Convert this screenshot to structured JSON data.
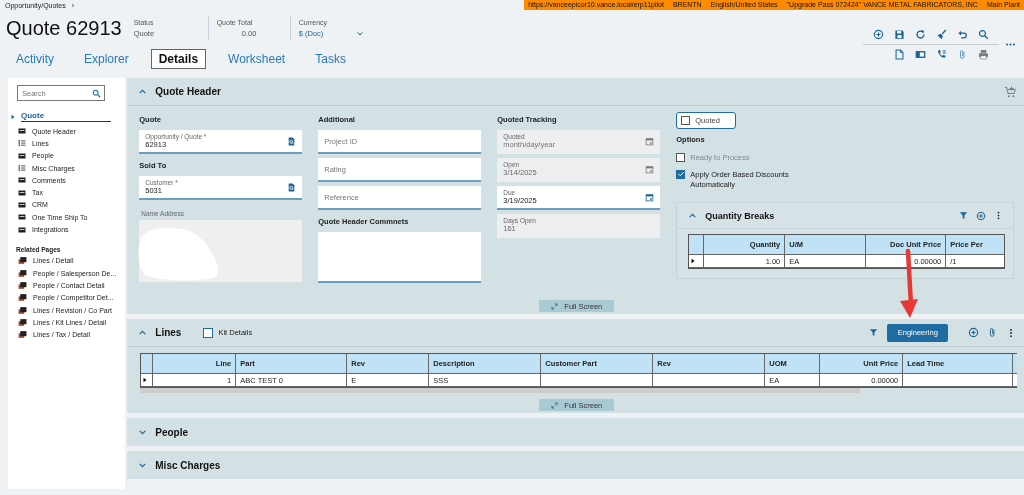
{
  "breadcrumb": {
    "text": "Opportunity/Quotes",
    "separator": "›"
  },
  "banner": [
    "https://vanceepicor10.vance.local/erp11pilot",
    "BRENTN",
    "English/United States",
    "\"Upgrade Pass 072424\" VANCE METAL FABRICATORS, INC",
    "Main Plant"
  ],
  "title": "Quote 62913",
  "summary": [
    {
      "kind": "text",
      "label": "Status",
      "value": "Quote"
    },
    {
      "kind": "number",
      "label": "Quote Total",
      "value": "0.00"
    },
    {
      "kind": "dropdown",
      "label": "Currency",
      "value": "$ (Doc)"
    }
  ],
  "tabs": [
    {
      "label": "Activity",
      "selected": false
    },
    {
      "label": "Explorer",
      "selected": false
    },
    {
      "label": "Details",
      "selected": true
    },
    {
      "label": "Worksheet",
      "selected": false
    },
    {
      "label": "Tasks",
      "selected": false
    }
  ],
  "sidebar": {
    "search_placeholder": "Search",
    "section": "Quote",
    "items": [
      {
        "label": "Quote Header",
        "kind": "form"
      },
      {
        "label": "Lines",
        "kind": "list"
      },
      {
        "label": "People",
        "kind": "form"
      },
      {
        "label": "Misc Charges",
        "kind": "list"
      },
      {
        "label": "Comments",
        "kind": "form"
      },
      {
        "label": "Tax",
        "kind": "form"
      },
      {
        "label": "CRM",
        "kind": "form"
      },
      {
        "label": "One Time Ship To",
        "kind": "form"
      },
      {
        "label": "Integrations",
        "kind": "form"
      }
    ],
    "related_title": "Related Pages",
    "related": [
      "Lines / Detail",
      "People / Salesperson De...",
      "People / Contact Detail",
      "People / Competitor Det...",
      "Lines / Revision / Co Part",
      "Lines / Kit Lines / Detail",
      "Lines / Tax / Detail"
    ]
  },
  "quote_header": {
    "title": "Quote Header",
    "expanded": true,
    "full_screen": "Full Screen",
    "columns": [
      [
        {
          "kind": "heading",
          "text": "Quote"
        },
        {
          "kind": "lookup",
          "label": "Opportunity / Quote *",
          "value": "62913"
        },
        {
          "kind": "heading",
          "text": "Sold To"
        },
        {
          "kind": "lookup",
          "label": "Customer *",
          "value": "5031"
        },
        {
          "kind": "memo",
          "label": "Name Address",
          "redacted": true
        }
      ],
      [
        {
          "kind": "heading",
          "text": "Additional"
        },
        {
          "kind": "input",
          "placeholder": "Project ID"
        },
        {
          "kind": "input",
          "placeholder": "Rating"
        },
        {
          "kind": "input",
          "placeholder": "Reference"
        },
        {
          "kind": "heading",
          "text": "Quote Header Commnets"
        },
        {
          "kind": "textarea"
        }
      ],
      [
        {
          "kind": "heading",
          "text": "Quoted Tracking"
        },
        {
          "kind": "date",
          "label": "Quoted",
          "placeholder": "month/day/year",
          "disabled": true
        },
        {
          "kind": "date",
          "label": "Open",
          "value": "3/14/2025",
          "disabled": true
        },
        {
          "kind": "date",
          "label": "Due",
          "value": "3/19/2025",
          "disabled": false
        },
        {
          "kind": "readonly",
          "label": "Days Open",
          "value": "161"
        }
      ],
      [
        {
          "kind": "toggle",
          "label": "Quoted",
          "checked": false
        },
        {
          "kind": "heading",
          "text": "Options"
        },
        {
          "kind": "checkbox",
          "label": "Ready to Process",
          "checked": false,
          "disabled": true
        },
        {
          "kind": "checkbox",
          "label": "Apply Order Based Discounts Automatically",
          "checked": true,
          "disabled": false
        },
        {
          "kind": "subgrid",
          "title": "Quantity Breaks",
          "expanded": true,
          "columns": [
            {
              "label": "Quantity",
              "numeric": true
            },
            {
              "label": "U/M",
              "numeric": false
            },
            {
              "label": "Doc Unit Price",
              "numeric": true
            },
            {
              "label": "Price Per",
              "numeric": false
            }
          ],
          "rows": [
            [
              "1.00",
              "EA",
              "0.00000",
              "/1"
            ]
          ]
        }
      ]
    ]
  },
  "lines": {
    "title": "Lines",
    "expanded": true,
    "kit_details": {
      "label": "Kit Details",
      "checked": false
    },
    "action": "Engineering",
    "full_screen": "Full Screen",
    "columns": [
      {
        "label": "Line",
        "numeric": true
      },
      {
        "label": "Part",
        "numeric": false
      },
      {
        "label": "Rev",
        "numeric": false
      },
      {
        "label": "Description",
        "numeric": false
      },
      {
        "label": "Customer Part",
        "numeric": false
      },
      {
        "label": "Rev",
        "numeric": false
      },
      {
        "label": "UOM",
        "numeric": false
      },
      {
        "label": "Unit Price",
        "numeric": true
      },
      {
        "label": "Lead Time",
        "numeric": false
      }
    ],
    "rows": [
      [
        "1",
        "ABC TEST 0",
        "E",
        "SSS",
        "",
        "",
        "EA",
        "0.00000",
        ""
      ]
    ]
  },
  "collapsed_panels": [
    {
      "title": "People",
      "expanded": false
    },
    {
      "title": "Misc Charges",
      "expanded": false
    }
  ]
}
